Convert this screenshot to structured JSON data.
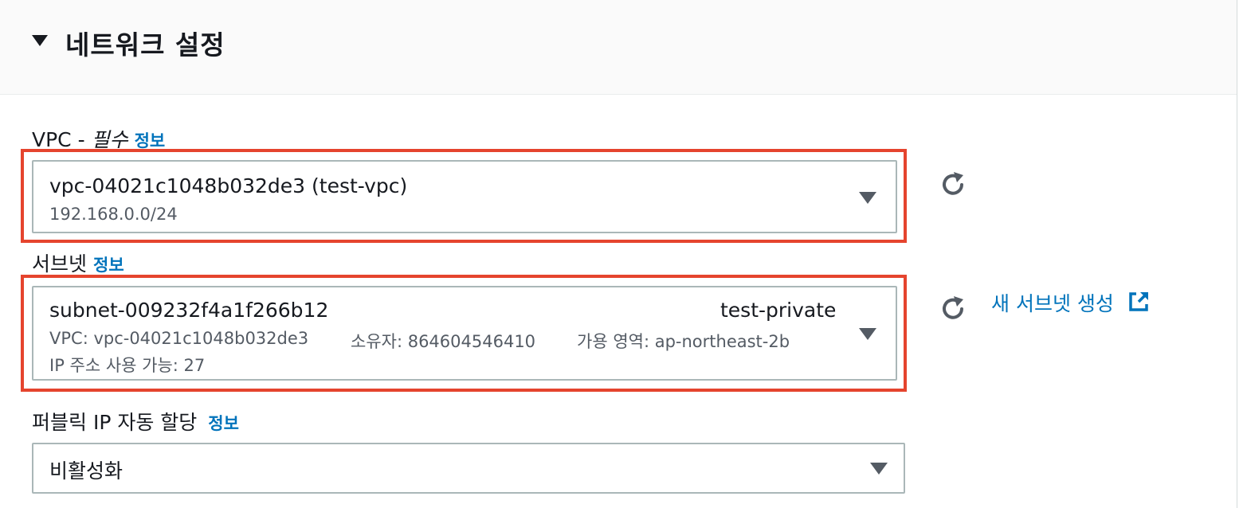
{
  "section": {
    "title": "네트워크 설정"
  },
  "vpc": {
    "label": "VPC - ",
    "required": "필수",
    "info": "정보",
    "selected_id": "vpc-04021c1048b032de3 (test-vpc)",
    "selected_cidr": "192.168.0.0/24"
  },
  "subnet": {
    "label": "서브넷",
    "info": "정보",
    "selected_id": "subnet-009232f4a1f266b12",
    "selected_name": "test-private",
    "vpc_detail": "VPC: vpc-04021c1048b032de3",
    "owner_detail": "소유자: 864604546410",
    "az_detail": "가용 영역: ap-northeast-2b",
    "ip_detail": "IP 주소 사용 가능: 27",
    "create_link": "새 서브넷 생성"
  },
  "public_ip": {
    "label": "퍼블릭 IP 자동 할당",
    "info": "정보",
    "selected": "비활성화"
  },
  "colors": {
    "highlight": "#e5442e",
    "link": "#0073bb",
    "text": "#16191f",
    "secondary_text": "#545b64"
  },
  "icons": {
    "section_toggle": "caret-down-icon",
    "refresh": "refresh-icon",
    "external_link": "external-link-icon",
    "dropdown": "caret-down-icon"
  }
}
